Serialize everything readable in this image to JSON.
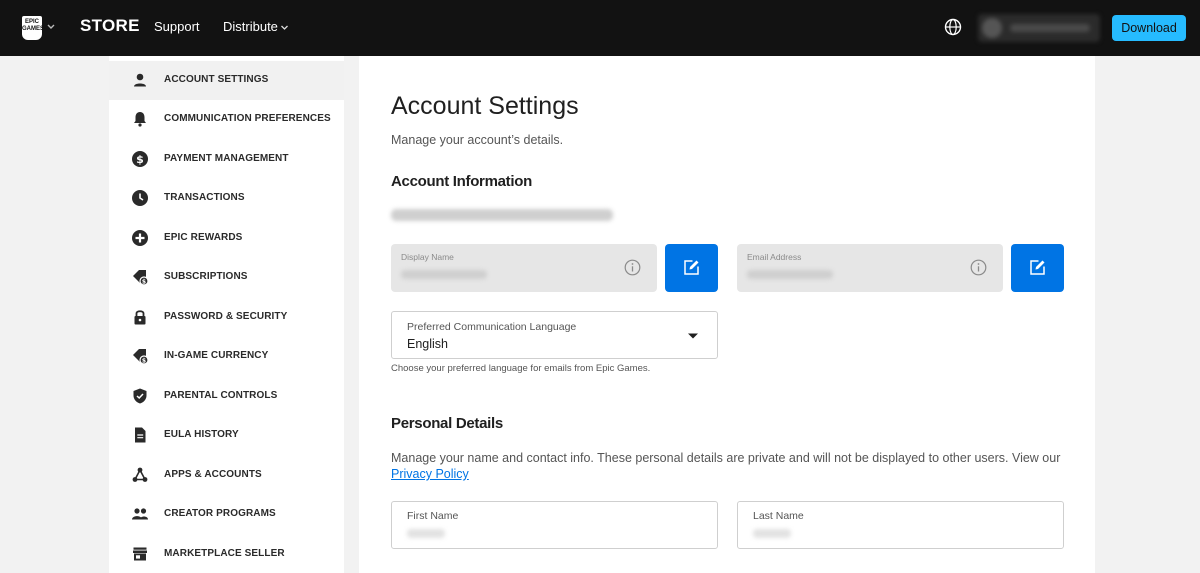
{
  "topnav": {
    "logo_text": "EPIC GAMES",
    "store": "STORE",
    "support": "Support",
    "distribute": "Distribute",
    "download": "Download",
    "colors": {
      "bar": "#121212",
      "download_bg": "#26bbff"
    }
  },
  "sidebar": {
    "items": [
      {
        "label": "ACCOUNT SETTINGS",
        "icon": "person-icon",
        "active": true
      },
      {
        "label": "COMMUNICATION PREFERENCES",
        "icon": "bell-icon"
      },
      {
        "label": "PAYMENT MANAGEMENT",
        "icon": "dollar-icon"
      },
      {
        "label": "TRANSACTIONS",
        "icon": "clock-icon"
      },
      {
        "label": "EPIC REWARDS",
        "icon": "rewards-icon"
      },
      {
        "label": "SUBSCRIPTIONS",
        "icon": "tag-icon"
      },
      {
        "label": "PASSWORD & SECURITY",
        "icon": "lock-icon"
      },
      {
        "label": "IN-GAME CURRENCY",
        "icon": "currency-tag-icon"
      },
      {
        "label": "PARENTAL CONTROLS",
        "icon": "shield-icon"
      },
      {
        "label": "EULA HISTORY",
        "icon": "document-icon"
      },
      {
        "label": "APPS & ACCOUNTS",
        "icon": "network-icon"
      },
      {
        "label": "CREATOR PROGRAMS",
        "icon": "group-icon"
      },
      {
        "label": "MARKETPLACE SELLER",
        "icon": "store-icon"
      }
    ]
  },
  "main": {
    "title": "Account Settings",
    "subtitle": "Manage your account’s details.",
    "account_info": {
      "heading": "Account Information",
      "display_name_label": "Display Name",
      "email_label": "Email Address"
    },
    "language": {
      "label": "Preferred Communication Language",
      "value": "English",
      "help": "Choose your preferred language for emails from Epic Games."
    },
    "personal": {
      "heading": "Personal Details",
      "description": "Manage your name and contact info. These personal details are private and will not be displayed to other users. View our",
      "privacy_link": "Privacy Policy",
      "first_name_label": "First Name",
      "last_name_label": "Last Name"
    },
    "colors": {
      "edit_button": "#0074e4",
      "link": "#0074e4"
    }
  }
}
